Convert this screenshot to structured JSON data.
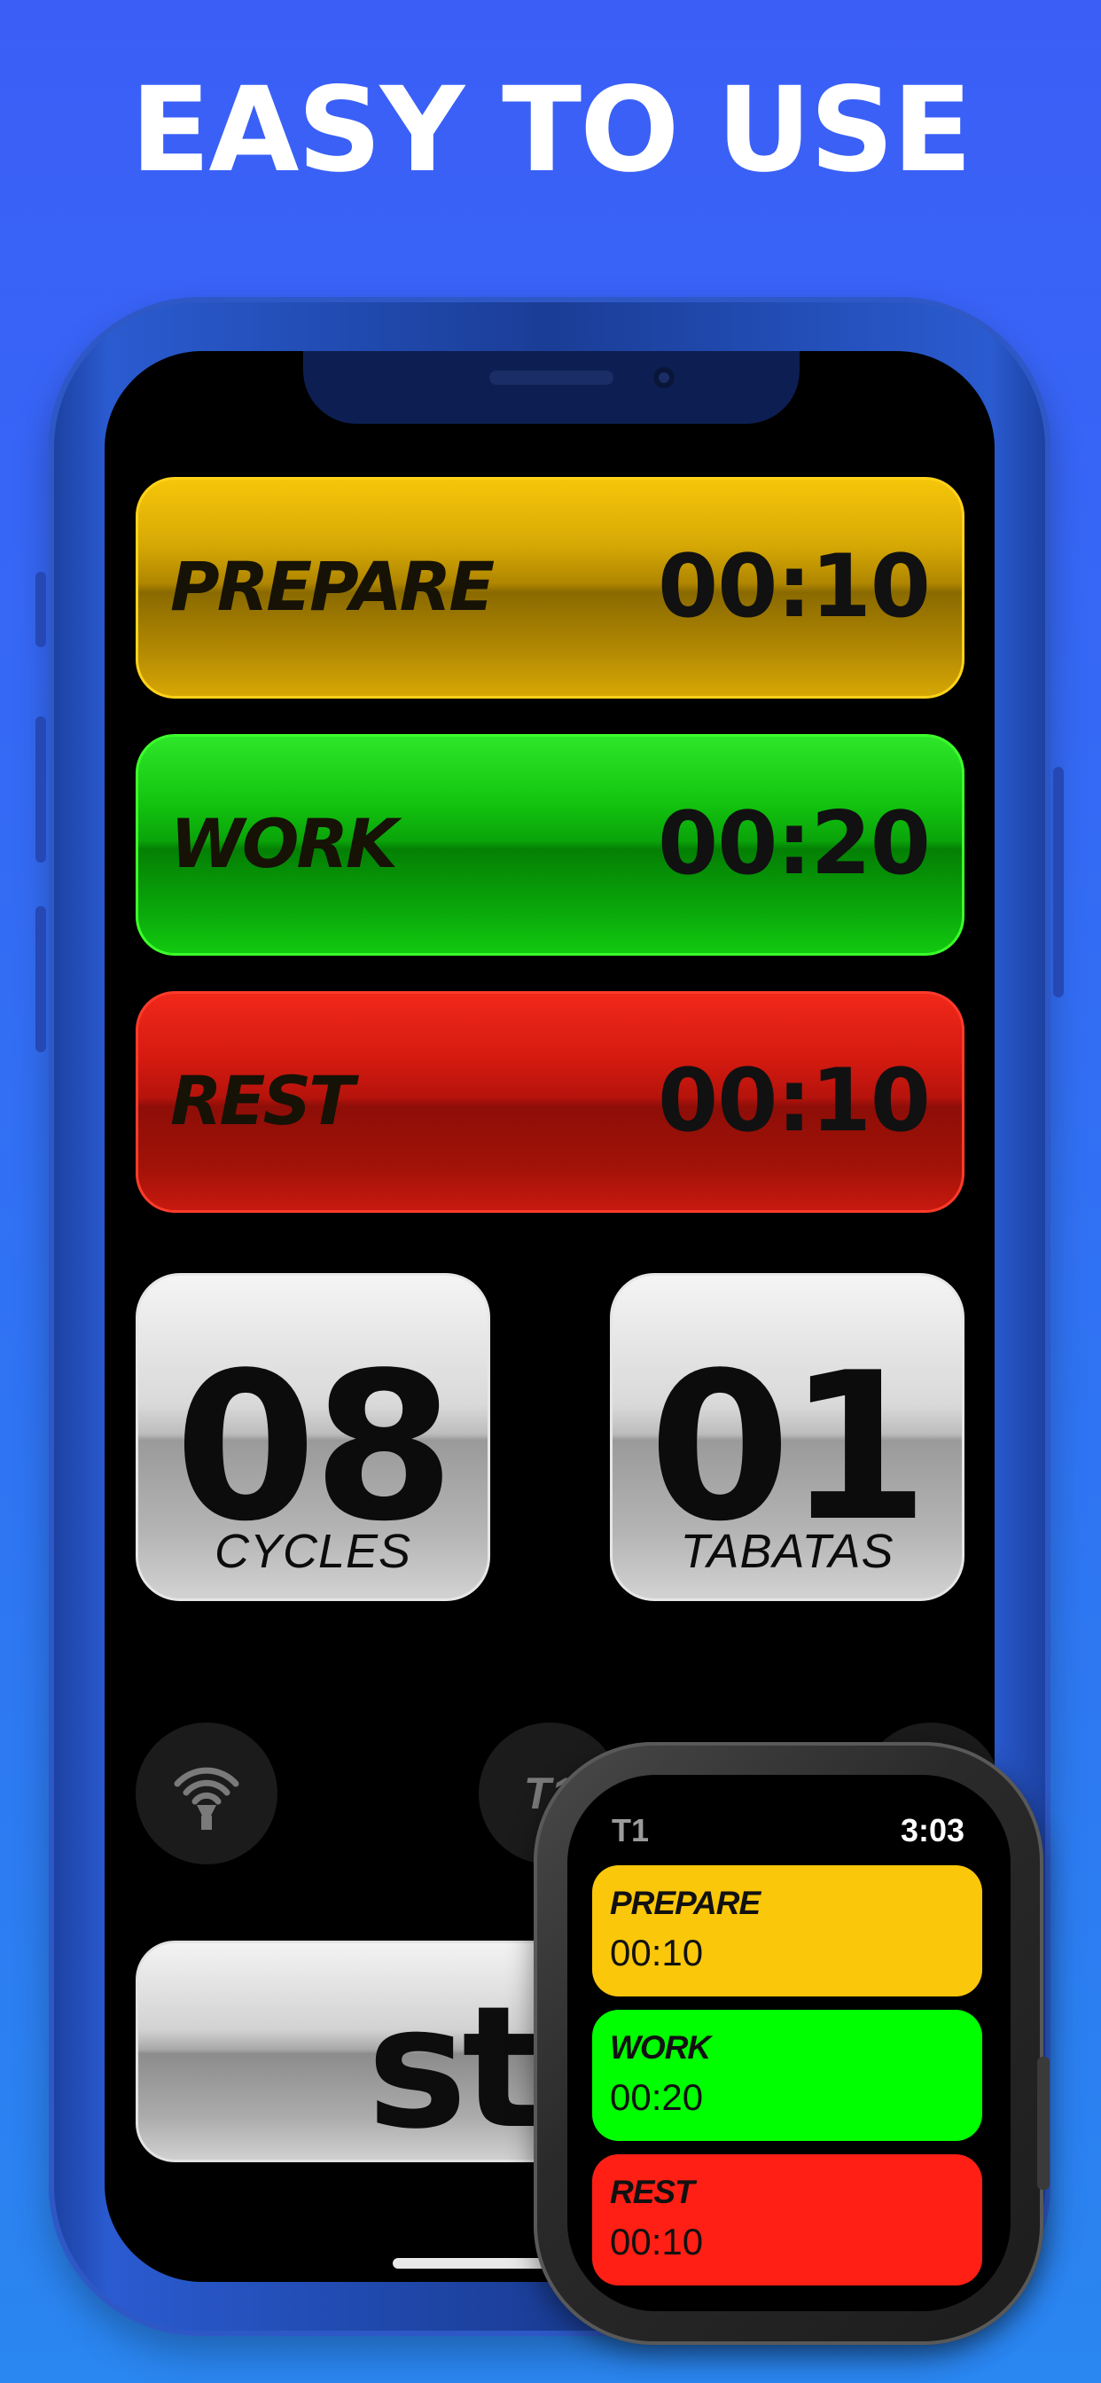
{
  "headline": "EASY TO USE",
  "phone": {
    "intervals": [
      {
        "label": "PREPARE",
        "time": "00:10",
        "color": "#d7a905"
      },
      {
        "label": "WORK",
        "time": "00:20",
        "color": "#13c50f"
      },
      {
        "label": "REST",
        "time": "00:10",
        "color": "#d51a10"
      }
    ],
    "cycles": {
      "value": "08",
      "label": "CYCLES"
    },
    "tabatas": {
      "value": "01",
      "label": "TABATAS"
    },
    "sound_button_icon": "speaker-wave-icon",
    "preset_button_label": "T1",
    "start_label": "sta"
  },
  "watch": {
    "title": "T1",
    "clock": "3:03",
    "intervals": [
      {
        "label": "PREPARE",
        "time": "00:10",
        "color": "#fbc70a"
      },
      {
        "label": "WORK",
        "time": "00:20",
        "color": "#00ff00"
      },
      {
        "label": "REST",
        "time": "00:10",
        "color": "#ff1f14"
      }
    ]
  }
}
